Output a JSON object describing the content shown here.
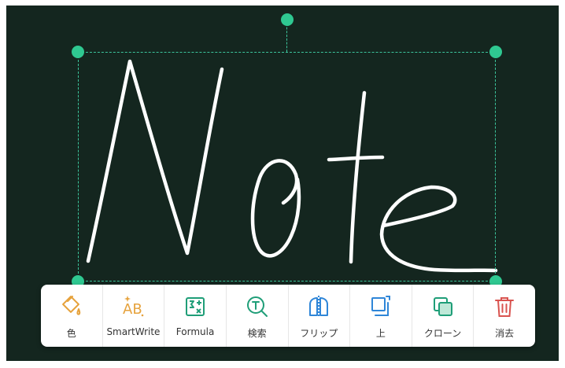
{
  "handwritten_text": "Note",
  "colors": {
    "board": "#14261f",
    "selection": "#3cc59c",
    "handle": "#2fc891",
    "ink": "#ffffff",
    "icon_color": "#e6a23c",
    "icon_smartwrite": "#e6a23c",
    "icon_formula": "#1f9e78",
    "icon_search": "#1f9e78",
    "icon_flip": "#2f86d8",
    "icon_top": "#2f86d8",
    "icon_clone": "#1f9e78",
    "icon_delete": "#d9534f"
  },
  "toolbar": {
    "items": [
      {
        "label": "色",
        "icon": "paint-bucket-icon"
      },
      {
        "label": "SmartWrite",
        "icon": "smartwrite-icon"
      },
      {
        "label": "Formula",
        "icon": "formula-icon"
      },
      {
        "label": "検索",
        "icon": "search-icon"
      },
      {
        "label": "フリップ",
        "icon": "flip-icon"
      },
      {
        "label": "上",
        "icon": "bring-to-front-icon"
      },
      {
        "label": "クローン",
        "icon": "clone-icon"
      },
      {
        "label": "消去",
        "icon": "trash-icon"
      }
    ]
  }
}
